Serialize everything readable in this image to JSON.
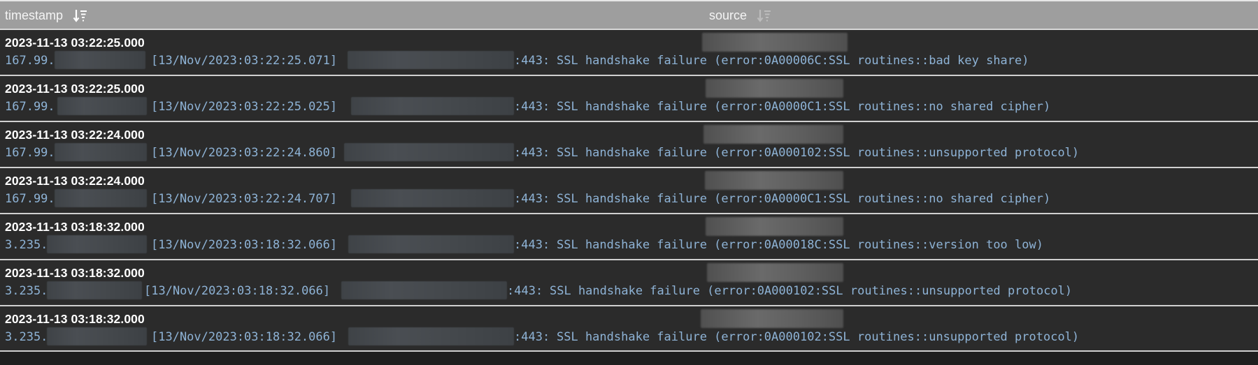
{
  "header": {
    "timestamp_label": "timestamp",
    "source_label": "source",
    "timestamp_sort_icon": "sort-descending-icon",
    "source_sort_icon": "sort-descending-icon"
  },
  "colors": {
    "header_bg": "#9e9e9e",
    "row_bg": "#2b2b2b",
    "message_text": "#8eb3d6",
    "timestamp_text": "#ffffff"
  },
  "rows": [
    {
      "timestamp": "2023-11-13 03:22:25.000",
      "ip_prefix": "167.99.",
      "log_time": "[13/Nov/2023:03:22:25.071]",
      "port": ":443:",
      "message": "SSL handshake failure (error:0A00006C:SSL routines::bad key share)"
    },
    {
      "timestamp": "2023-11-13 03:22:25.000",
      "ip_prefix": "167.99.",
      "log_time": "[13/Nov/2023:03:22:25.025]",
      "port": ":443:",
      "message": "SSL handshake failure (error:0A0000C1:SSL routines::no shared cipher)"
    },
    {
      "timestamp": "2023-11-13 03:22:24.000",
      "ip_prefix": "167.99.",
      "log_time": "[13/Nov/2023:03:22:24.860]",
      "port": ":443:",
      "message": "SSL handshake failure (error:0A000102:SSL routines::unsupported protocol)"
    },
    {
      "timestamp": "2023-11-13 03:22:24.000",
      "ip_prefix": "167.99.",
      "log_time": "[13/Nov/2023:03:22:24.707]",
      "port": ":443:",
      "message": "SSL handshake failure (error:0A0000C1:SSL routines::no shared cipher)"
    },
    {
      "timestamp": "2023-11-13 03:18:32.000",
      "ip_prefix": "3.235.",
      "log_time": "[13/Nov/2023:03:18:32.066]",
      "port": ":443:",
      "message": "SSL handshake failure (error:0A00018C:SSL routines::version too low)"
    },
    {
      "timestamp": "2023-11-13 03:18:32.000",
      "ip_prefix": "3.235.",
      "log_time": "[13/Nov/2023:03:18:32.066]",
      "port": ":443:",
      "message": "SSL handshake failure (error:0A000102:SSL routines::unsupported protocol)"
    },
    {
      "timestamp": "2023-11-13 03:18:32.000",
      "ip_prefix": "3.235.",
      "log_time": "[13/Nov/2023:03:18:32.066]",
      "port": ":443:",
      "message": "SSL handshake failure (error:0A000102:SSL routines::unsupported protocol)"
    }
  ]
}
